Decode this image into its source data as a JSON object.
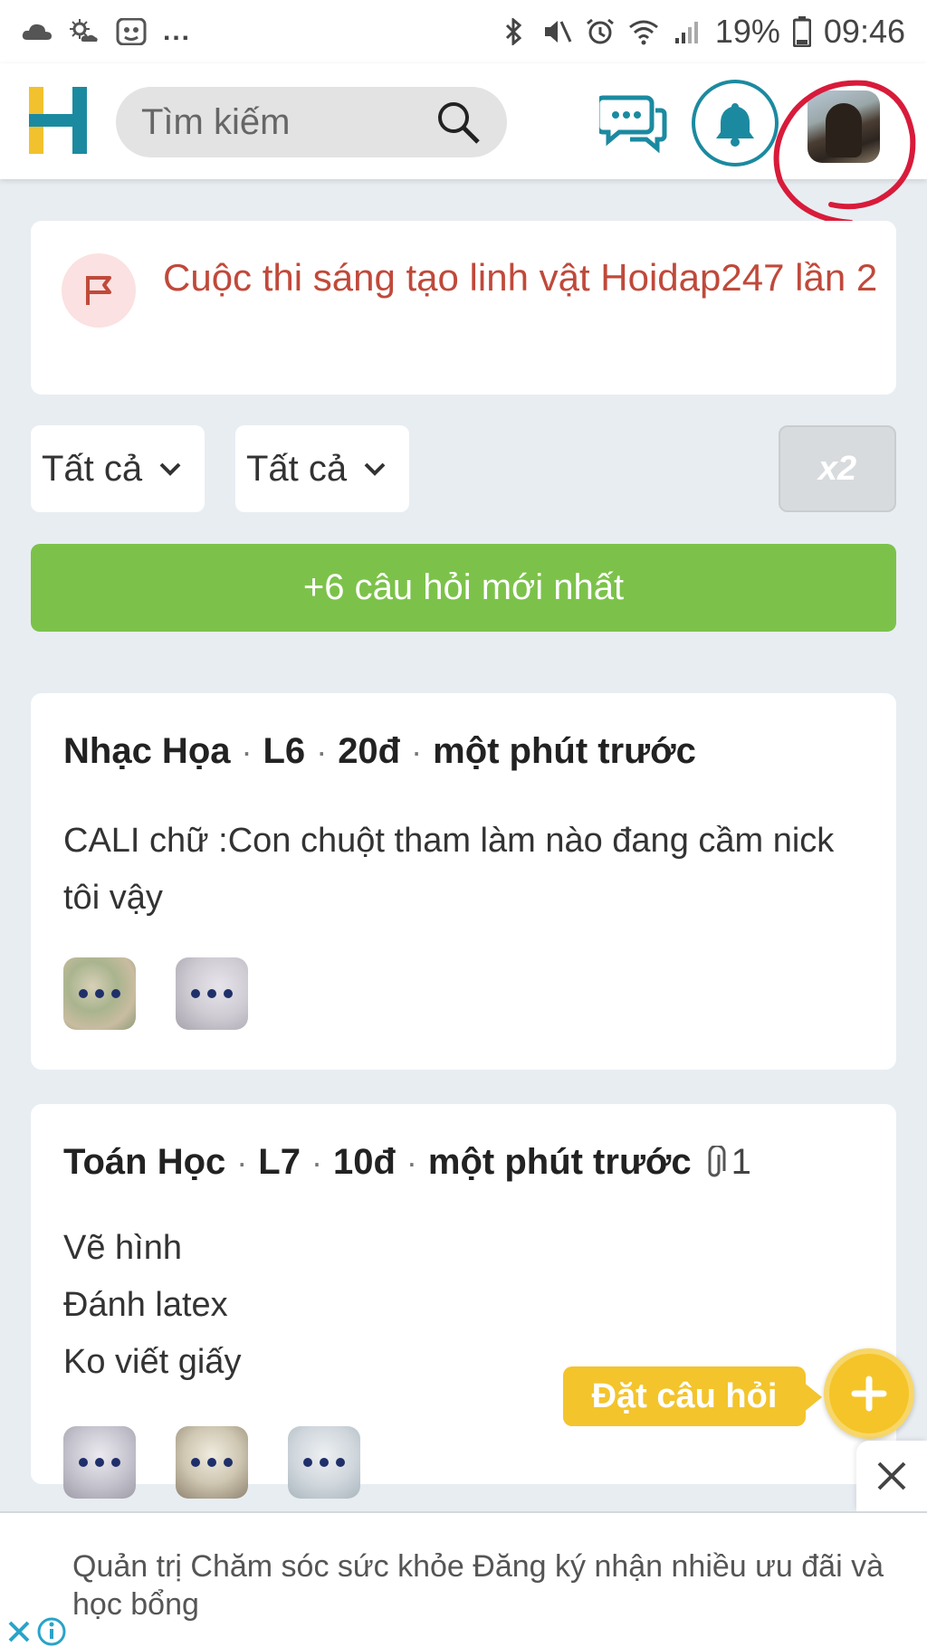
{
  "status_bar": {
    "battery": "19%",
    "time": "09:46",
    "more": "..."
  },
  "header": {
    "search_placeholder": "Tìm kiếm"
  },
  "contest_banner": {
    "text": "Cuộc thi sáng tạo linh vật Hoidap247 lần 2"
  },
  "filters": {
    "subject": "Tất cả",
    "grade": "Tất cả",
    "multiplier": "x2"
  },
  "new_questions": {
    "label": "+6 câu hỏi mới nhất"
  },
  "questions": [
    {
      "subject": "Nhạc Họa",
      "grade": "L6",
      "points": "20đ",
      "time": "một phút trước",
      "lines": [
        "CALI chữ :Con chuột tham làm nào đang cầm nick tôi vậy"
      ]
    },
    {
      "subject": "Toán Học",
      "grade": "L7",
      "points": "10đ",
      "time": "một phút trước",
      "attachments": "1",
      "lines": [
        "Vẽ hình",
        "Đánh latex",
        "Ko viết giấy"
      ]
    }
  ],
  "fab": {
    "label": "Đặt câu hỏi"
  },
  "ad": {
    "text": "Quản trị Chăm sóc sức khỏe Đăng ký nhận nhiều ưu đãi và học bổng"
  },
  "colors": {
    "accent_green": "#7cc24a",
    "contest_red": "#c0493a",
    "fab_yellow": "#f3c42c",
    "teal": "#1b8aa0"
  }
}
